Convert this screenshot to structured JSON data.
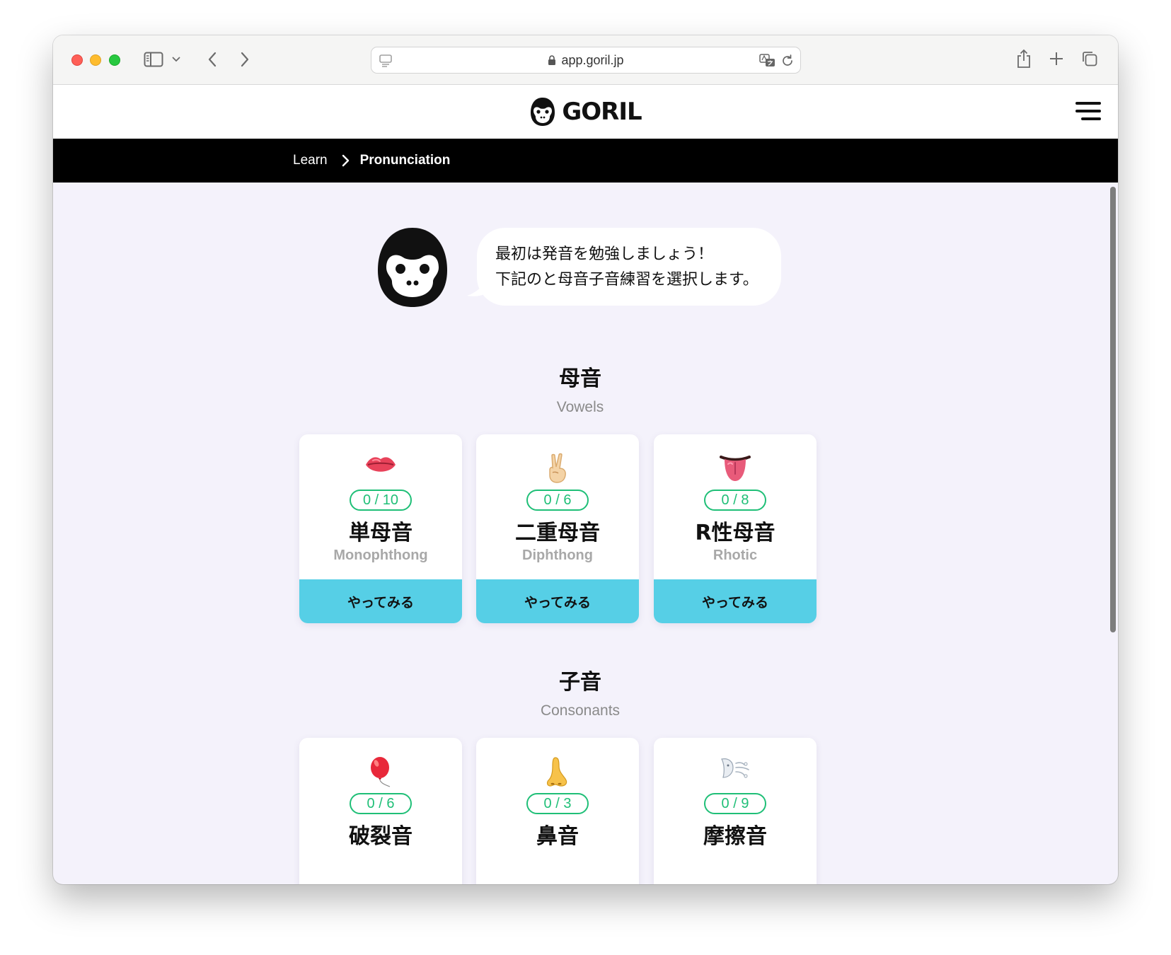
{
  "browser": {
    "url": "app.goril.jp"
  },
  "site": {
    "brand": "GORIL"
  },
  "breadcrumb": {
    "items": [
      {
        "label": "Learn"
      },
      {
        "label": "Pronunciation"
      }
    ]
  },
  "intro": {
    "line1": "最初は発音を勉強しましょう！",
    "line2": "下記のと母音子音練習を選択します。"
  },
  "vowels": {
    "title": "母音",
    "subtitle": "Vowels",
    "cards": [
      {
        "icon": "lips-icon",
        "progress": "0 / 10",
        "title": "単母音",
        "subtitle": "Monophthong",
        "action": "やってみる"
      },
      {
        "icon": "victory-hand-icon",
        "progress": "0 / 6",
        "title": "二重母音",
        "subtitle": "Diphthong",
        "action": "やってみる"
      },
      {
        "icon": "tongue-icon",
        "progress": "0 / 8",
        "title": "R性母音",
        "subtitle": "Rhotic",
        "action": "やってみる"
      }
    ]
  },
  "consonants": {
    "title": "子音",
    "subtitle": "Consonants",
    "cards": [
      {
        "icon": "balloon-icon",
        "progress": "0 / 6",
        "title": "破裂音"
      },
      {
        "icon": "nose-icon",
        "progress": "0 / 3",
        "title": "鼻音"
      },
      {
        "icon": "wind-face-icon",
        "progress": "0 / 9",
        "title": "摩擦音"
      }
    ]
  },
  "colors": {
    "accent_cyan": "#56cfe6",
    "progress_green": "#1fbf77",
    "page_bg": "#f4f2fb",
    "breadcrumb_bg": "#000000"
  }
}
